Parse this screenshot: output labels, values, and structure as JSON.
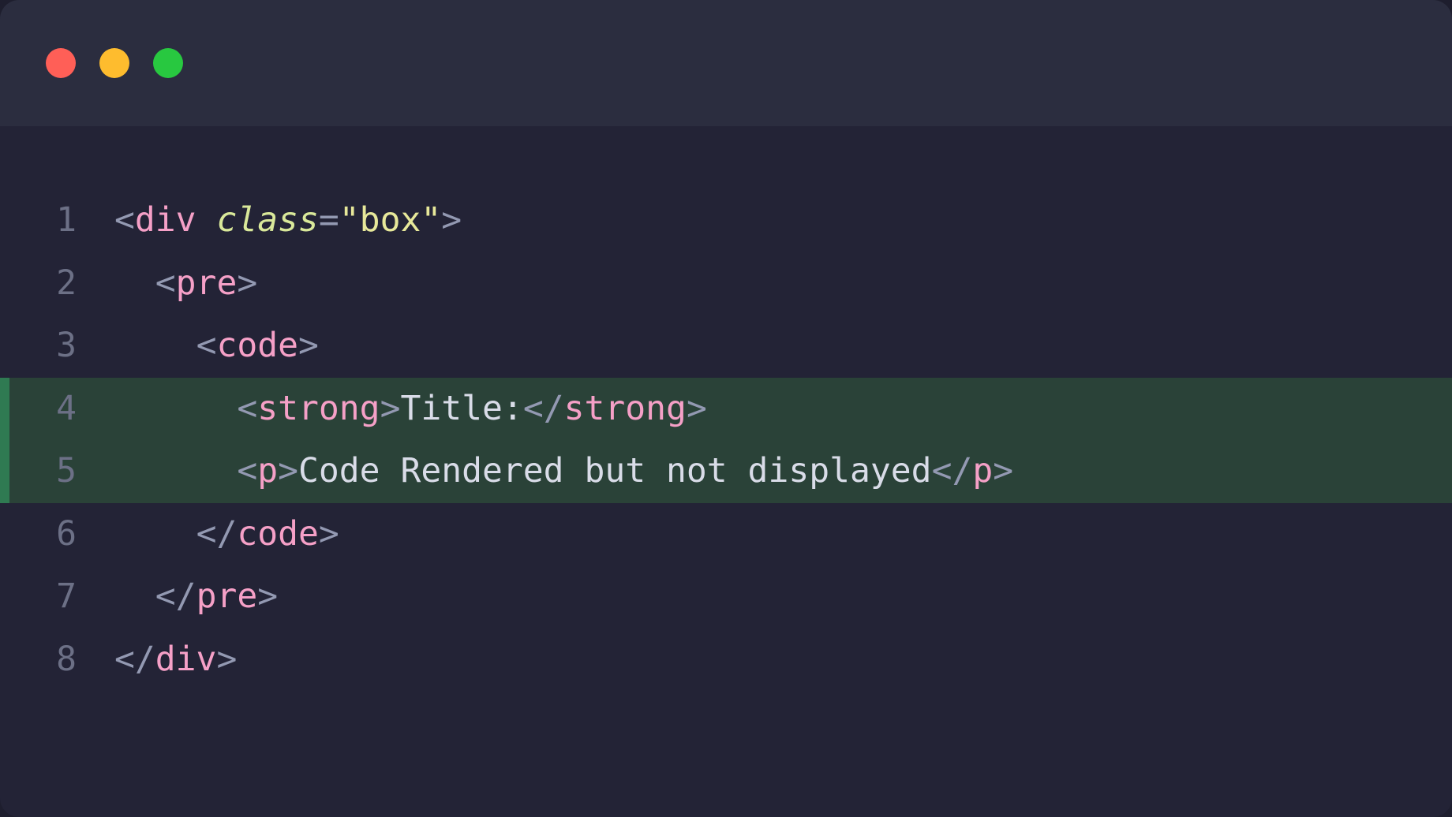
{
  "editor": {
    "lines": [
      {
        "num": "1",
        "hl": false,
        "indent": "",
        "tokens": [
          {
            "cls": "punct",
            "t": "<"
          },
          {
            "cls": "tag",
            "t": "div"
          },
          {
            "cls": "text",
            "t": " "
          },
          {
            "cls": "attr",
            "t": "class"
          },
          {
            "cls": "op",
            "t": "="
          },
          {
            "cls": "str",
            "t": "\"box\""
          },
          {
            "cls": "punct",
            "t": ">"
          }
        ]
      },
      {
        "num": "2",
        "hl": false,
        "indent": "  ",
        "tokens": [
          {
            "cls": "punct",
            "t": "<"
          },
          {
            "cls": "tag",
            "t": "pre"
          },
          {
            "cls": "punct",
            "t": ">"
          }
        ]
      },
      {
        "num": "3",
        "hl": false,
        "indent": "    ",
        "tokens": [
          {
            "cls": "punct",
            "t": "<"
          },
          {
            "cls": "tag",
            "t": "code"
          },
          {
            "cls": "punct",
            "t": ">"
          }
        ]
      },
      {
        "num": "4",
        "hl": true,
        "indent": "      ",
        "tokens": [
          {
            "cls": "punct",
            "t": "<"
          },
          {
            "cls": "tag",
            "t": "strong"
          },
          {
            "cls": "punct",
            "t": ">"
          },
          {
            "cls": "text",
            "t": "Title:"
          },
          {
            "cls": "punct",
            "t": "</"
          },
          {
            "cls": "tag",
            "t": "strong"
          },
          {
            "cls": "punct",
            "t": ">"
          }
        ]
      },
      {
        "num": "5",
        "hl": true,
        "indent": "      ",
        "tokens": [
          {
            "cls": "punct",
            "t": "<"
          },
          {
            "cls": "tag",
            "t": "p"
          },
          {
            "cls": "punct",
            "t": ">"
          },
          {
            "cls": "text",
            "t": "Code Rendered but not displayed"
          },
          {
            "cls": "punct",
            "t": "</"
          },
          {
            "cls": "tag",
            "t": "p"
          },
          {
            "cls": "punct",
            "t": ">"
          }
        ]
      },
      {
        "num": "6",
        "hl": false,
        "indent": "    ",
        "tokens": [
          {
            "cls": "punct",
            "t": "</"
          },
          {
            "cls": "tag",
            "t": "code"
          },
          {
            "cls": "punct",
            "t": ">"
          }
        ]
      },
      {
        "num": "7",
        "hl": false,
        "indent": "  ",
        "tokens": [
          {
            "cls": "punct",
            "t": "</"
          },
          {
            "cls": "tag",
            "t": "pre"
          },
          {
            "cls": "punct",
            "t": ">"
          }
        ]
      },
      {
        "num": "8",
        "hl": false,
        "indent": "",
        "tokens": [
          {
            "cls": "punct",
            "t": "</"
          },
          {
            "cls": "tag",
            "t": "div"
          },
          {
            "cls": "punct",
            "t": ">"
          }
        ]
      }
    ]
  }
}
